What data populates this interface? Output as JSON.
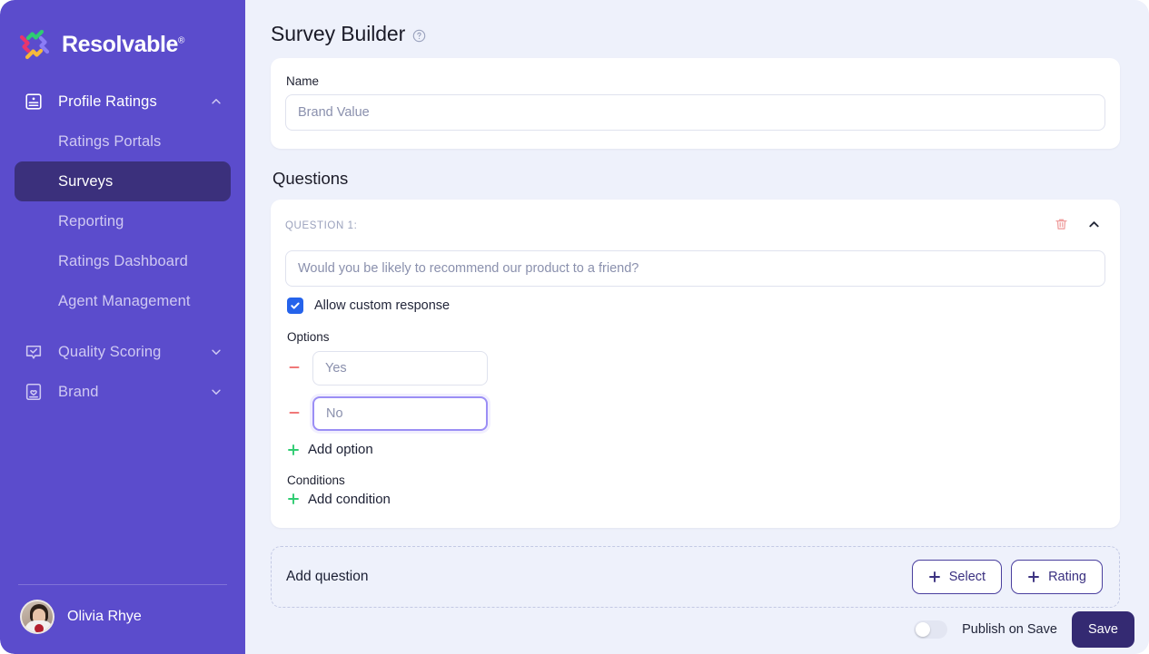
{
  "brand": {
    "name": "Resolvable",
    "registered_mark": "®",
    "logo_icon": "pinwheel-logo-icon",
    "logo_colors": {
      "green": "#2ecc71",
      "purple": "#8b7cf6",
      "yellow": "#f5b93a",
      "pink": "#e8356d"
    }
  },
  "sidebar": {
    "background_color": "#5b4ccc",
    "active_color": "#3b307c",
    "groups": [
      {
        "label": "Profile Ratings",
        "icon": "id-card-icon",
        "chevron": "chevron-up-icon",
        "expanded": true,
        "items": [
          {
            "label": "Ratings Portals",
            "active": false
          },
          {
            "label": "Surveys",
            "active": true
          },
          {
            "label": "Reporting",
            "active": false
          },
          {
            "label": "Ratings Dashboard",
            "active": false
          },
          {
            "label": "Agent Management",
            "active": false
          }
        ]
      },
      {
        "label": "Quality Scoring",
        "icon": "speech-bubble-check-icon",
        "chevron": "chevron-down-icon",
        "expanded": false,
        "items": []
      },
      {
        "label": "Brand",
        "icon": "document-heart-icon",
        "chevron": "chevron-down-icon",
        "expanded": false,
        "items": []
      }
    ],
    "user": {
      "name": "Olivia Rhye",
      "avatar": "user-avatar"
    }
  },
  "page": {
    "title": "Survey Builder",
    "help_icon": "help-circle-icon"
  },
  "name_card": {
    "label": "Name",
    "input_placeholder": "Brand Value",
    "input_value": ""
  },
  "questions_section": {
    "title": "Questions"
  },
  "question": {
    "number_label": "QUESTION 1:",
    "delete_icon": "trash-icon",
    "collapse_icon": "chevron-up-icon",
    "text_placeholder": "Would you be likely to recommend our product to a friend?",
    "text_value": "",
    "allow_custom": {
      "label": "Allow custom response",
      "checked": true,
      "checkbox_color": "#2563eb",
      "check_icon": "checkmark-icon"
    },
    "options_label": "Options",
    "options": [
      {
        "placeholder": "Yes",
        "value": "",
        "focused": false,
        "remove_icon": "minus-icon"
      },
      {
        "placeholder": "No",
        "value": "",
        "focused": true,
        "remove_icon": "minus-icon"
      }
    ],
    "add_option_label": "Add option",
    "add_option_icon": "plus-icon",
    "conditions_label": "Conditions",
    "add_condition_label": "Add condition",
    "add_condition_icon": "plus-icon",
    "accent_green": "#2ecc71",
    "accent_red": "#f08a8a"
  },
  "add_question_card": {
    "label": "Add question",
    "buttons": [
      {
        "label": "Select",
        "icon": "plus-icon"
      },
      {
        "label": "Rating",
        "icon": "plus-icon"
      }
    ]
  },
  "bottom_bar": {
    "toggle_label": "Publish on Save",
    "toggle_on": false,
    "save_label": "Save",
    "save_color": "#342a72"
  }
}
